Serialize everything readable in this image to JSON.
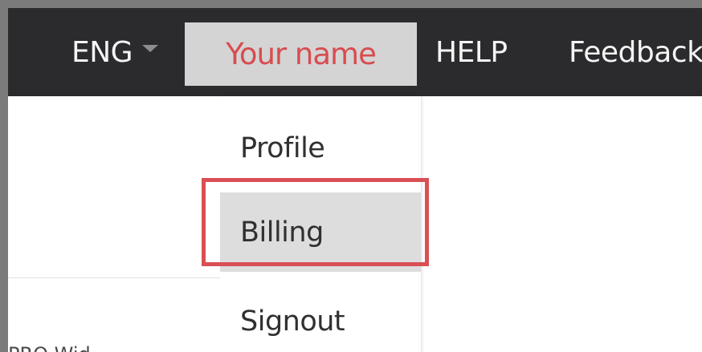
{
  "navbar": {
    "language": "ENG",
    "user_name": "Your name",
    "help": "HELP",
    "feedback": "Feedback"
  },
  "dropdown": {
    "items": [
      {
        "label": "Profile"
      },
      {
        "label": "Billing"
      },
      {
        "label": "Signout"
      }
    ]
  },
  "page": {
    "fragment_text": "PRO Wid"
  },
  "colors": {
    "navbar_background": "#2b2b2d",
    "user_text": "#d84c50",
    "highlight_border": "#d94f53"
  }
}
